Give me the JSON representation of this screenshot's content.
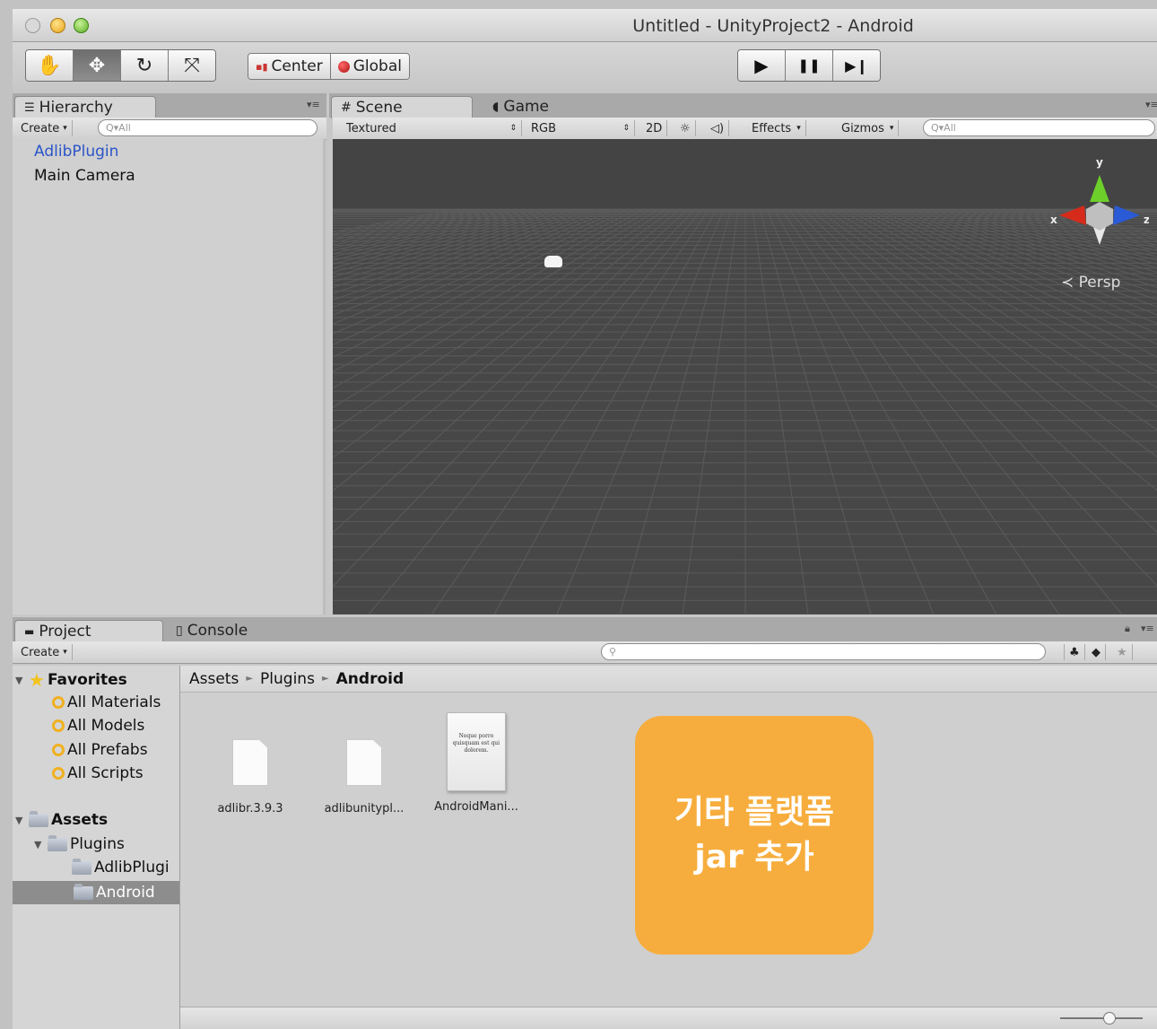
{
  "window": {
    "title": "Untitled - UnityProject2 - Android"
  },
  "toolbar": {
    "tools": [
      {
        "name": "hand-tool-button",
        "icon": "hand-icon",
        "glyph": "✋",
        "active": false
      },
      {
        "name": "move-tool-button",
        "icon": "move-icon",
        "glyph": "✥",
        "active": true
      },
      {
        "name": "rotate-tool-button",
        "icon": "rotate-icon",
        "glyph": "↻",
        "active": false
      },
      {
        "name": "scale-tool-button",
        "icon": "scale-icon",
        "glyph": "⤧",
        "active": false
      }
    ],
    "pivot_label": "Center",
    "space_label": "Global",
    "play_controls": [
      {
        "name": "play-button",
        "icon": "play-icon",
        "glyph": "▶"
      },
      {
        "name": "pause-button",
        "icon": "pause-icon",
        "glyph": "❚❚"
      },
      {
        "name": "step-button",
        "icon": "step-icon",
        "glyph": "▶❙"
      }
    ]
  },
  "hierarchy": {
    "tab_label": "Hierarchy",
    "create_label": "Create",
    "search_placeholder": "Q▾All",
    "items": [
      {
        "label": "AdlibPlugin",
        "selected": true
      },
      {
        "label": "Main Camera",
        "selected": false
      }
    ]
  },
  "scene": {
    "tab_scene": "Scene",
    "tab_game": "Game",
    "shading_mode": "Textured",
    "render_mode": "RGB",
    "mode_2d": "2D",
    "effects_label": "Effects",
    "gizmos_label": "Gizmos",
    "search_placeholder": "Q▾All",
    "gizmo": {
      "x": "x",
      "y": "y",
      "z": "z",
      "projection": "Persp"
    },
    "colors": {
      "background": "#474747",
      "y_axis": "#6ccf2a",
      "x_axis": "#d62a1a",
      "z_axis": "#2a5ad6"
    }
  },
  "project": {
    "tab_project": "Project",
    "tab_console": "Console",
    "create_label": "Create",
    "favorites": {
      "label": "Favorites",
      "items": [
        "All Materials",
        "All Models",
        "All Prefabs",
        "All Scripts"
      ]
    },
    "assets": {
      "label": "Assets",
      "plugins": "Plugins",
      "children": [
        "AdlibPlugi",
        "Android"
      ],
      "selected": "Android"
    },
    "breadcrumb": [
      "Assets",
      "Plugins",
      "Android"
    ],
    "files": [
      {
        "label": "adlibr.3.9.3",
        "kind": "file"
      },
      {
        "label": "adlibunitypl...",
        "kind": "file"
      },
      {
        "label": "AndroidMani...",
        "kind": "document",
        "preview": "Neque porro quisquam est qui dolorem."
      }
    ]
  },
  "callout": {
    "line1": "기타 플랫폼",
    "line2": "jar 추가",
    "color": "#f7ad3d"
  }
}
